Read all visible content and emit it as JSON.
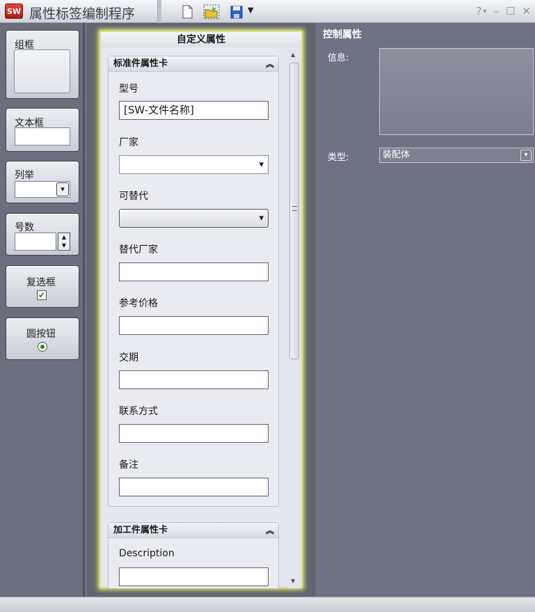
{
  "app": {
    "logo_text": "SW",
    "title": "属性标签编制程序",
    "accent": "#d9e08a"
  },
  "toolbar": {
    "icons": [
      "new-file-icon",
      "open-folder-icon",
      "save-icon",
      "dropdown-arrow-icon"
    ]
  },
  "window_controls": {
    "help": "?",
    "help_dropdown": "▾",
    "minimize": "–",
    "maximize": "☐",
    "close": "✕"
  },
  "toolbox": {
    "groupbox": "组框",
    "textbox": "文本框",
    "list": "列举",
    "number": "号数",
    "checkbox": "复选框",
    "radio": "圆按钮"
  },
  "panel": {
    "title": "自定义属性",
    "groups": [
      {
        "title": "标准件属性卡",
        "fields": [
          {
            "label": "型号",
            "value": "[SW-文件名称]",
            "kind": "text"
          },
          {
            "label": "厂家",
            "value": "",
            "kind": "combo"
          },
          {
            "label": "可替代",
            "value": "",
            "kind": "combo-disabled"
          },
          {
            "label": "替代厂家",
            "value": "",
            "kind": "text"
          },
          {
            "label": "参考价格",
            "value": "",
            "kind": "text"
          },
          {
            "label": "交期",
            "value": "",
            "kind": "text"
          },
          {
            "label": "联系方式",
            "value": "",
            "kind": "text"
          },
          {
            "label": "备注",
            "value": "",
            "kind": "text"
          }
        ]
      },
      {
        "title": "加工件属性卡",
        "fields": [
          {
            "label": "Description",
            "value": "",
            "kind": "text"
          }
        ]
      }
    ]
  },
  "props": {
    "title": "控制属性",
    "info_label": "信息:",
    "type_label": "类型:",
    "type_value": "装配体"
  }
}
